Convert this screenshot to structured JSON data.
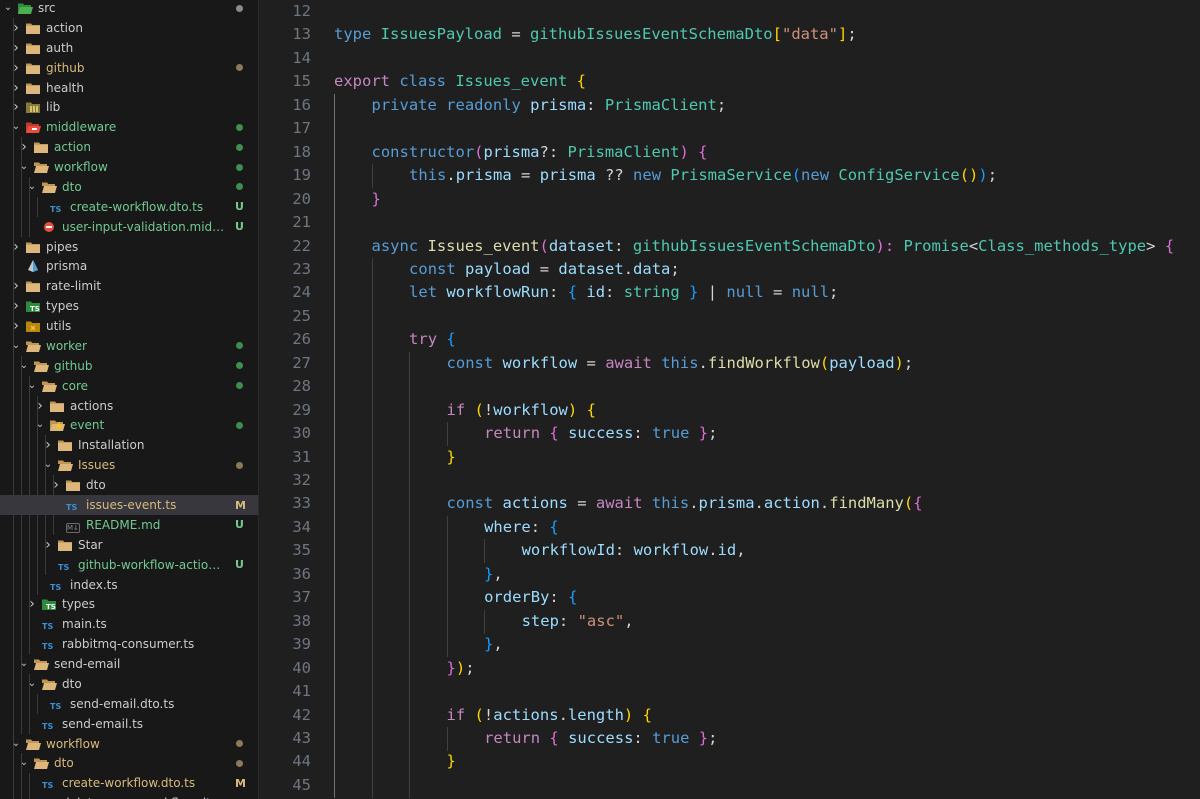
{
  "explorer": {
    "items": [
      {
        "label": "src",
        "kind": "folder-src",
        "depth": 0,
        "state": "open",
        "dot": "#8b8b8b"
      },
      {
        "label": "action",
        "kind": "folder",
        "depth": 1,
        "state": "closed"
      },
      {
        "label": "auth",
        "kind": "folder",
        "depth": 1,
        "state": "closed"
      },
      {
        "label": "github",
        "kind": "folder",
        "depth": 1,
        "state": "closed",
        "labelColor": "#d7ba7d",
        "dot": "#8a7a5a"
      },
      {
        "label": "health",
        "kind": "folder",
        "depth": 1,
        "state": "closed"
      },
      {
        "label": "lib",
        "kind": "folder-lib",
        "depth": 1,
        "state": "closed"
      },
      {
        "label": "middleware",
        "kind": "folder-mw",
        "depth": 1,
        "state": "open",
        "labelColor": "#73c991",
        "dot": "#3e8f4f"
      },
      {
        "label": "action",
        "kind": "folder",
        "depth": 2,
        "state": "closed",
        "labelColor": "#73c991",
        "dot": "#3e8f4f"
      },
      {
        "label": "workflow",
        "kind": "folder",
        "depth": 2,
        "state": "open",
        "labelColor": "#73c991",
        "dot": "#3e8f4f"
      },
      {
        "label": "dto",
        "kind": "folder",
        "depth": 3,
        "state": "open",
        "labelColor": "#73c991",
        "dot": "#3e8f4f"
      },
      {
        "label": "create-workflow.dto.ts",
        "kind": "ts",
        "depth": 4,
        "labelColor": "#73c991",
        "badge": "U",
        "badgeColor": "#73c991"
      },
      {
        "label": "user-input-validation.middlewar...",
        "kind": "mw",
        "depth": 3,
        "labelColor": "#73c991",
        "badge": "U",
        "badgeColor": "#73c991"
      },
      {
        "label": "pipes",
        "kind": "folder",
        "depth": 1,
        "state": "closed"
      },
      {
        "label": "prisma",
        "kind": "prisma",
        "depth": 1,
        "state": "closed"
      },
      {
        "label": "rate-limit",
        "kind": "folder",
        "depth": 1,
        "state": "closed"
      },
      {
        "label": "types",
        "kind": "folder-types",
        "depth": 1,
        "state": "closed"
      },
      {
        "label": "utils",
        "kind": "folder-utils",
        "depth": 1,
        "state": "closed"
      },
      {
        "label": "worker",
        "kind": "folder",
        "depth": 1,
        "state": "open",
        "labelColor": "#73c991",
        "dot": "#3e8f4f"
      },
      {
        "label": "github",
        "kind": "folder",
        "depth": 2,
        "state": "open",
        "labelColor": "#73c991",
        "dot": "#3e8f4f"
      },
      {
        "label": "core",
        "kind": "folder",
        "depth": 3,
        "state": "open",
        "labelColor": "#73c991",
        "dot": "#3e8f4f"
      },
      {
        "label": "actions",
        "kind": "folder",
        "depth": 4,
        "state": "closed"
      },
      {
        "label": "event",
        "kind": "folder-event",
        "depth": 4,
        "state": "open",
        "labelColor": "#73c991",
        "dot": "#3e8f4f"
      },
      {
        "label": "Installation",
        "kind": "folder",
        "depth": 5,
        "state": "closed"
      },
      {
        "label": "Issues",
        "kind": "folder",
        "depth": 5,
        "state": "open",
        "labelColor": "#d7ba7d",
        "dot": "#8a7a5a"
      },
      {
        "label": "dto",
        "kind": "folder",
        "depth": 6,
        "state": "closed"
      },
      {
        "label": "issues-event.ts",
        "kind": "ts",
        "depth": 6,
        "labelColor": "#d7ba7d",
        "badge": "M",
        "badgeColor": "#d7ba7d",
        "selected": true
      },
      {
        "label": "README.md",
        "kind": "md",
        "depth": 6,
        "labelColor": "#73c991",
        "badge": "U",
        "badgeColor": "#73c991"
      },
      {
        "label": "Star",
        "kind": "folder",
        "depth": 5,
        "state": "closed"
      },
      {
        "label": "github-workflow-action-rules...",
        "kind": "ts",
        "depth": 5,
        "labelColor": "#73c991",
        "badge": "U",
        "badgeColor": "#73c991"
      },
      {
        "label": "index.ts",
        "kind": "ts",
        "depth": 4
      },
      {
        "label": "types",
        "kind": "folder-types",
        "depth": 3,
        "state": "closed"
      },
      {
        "label": "main.ts",
        "kind": "ts",
        "depth": 3
      },
      {
        "label": "rabbitmq-consumer.ts",
        "kind": "ts",
        "depth": 3
      },
      {
        "label": "send-email",
        "kind": "folder",
        "depth": 2,
        "state": "open"
      },
      {
        "label": "dto",
        "kind": "folder",
        "depth": 3,
        "state": "open"
      },
      {
        "label": "send-email.dto.ts",
        "kind": "ts",
        "depth": 4
      },
      {
        "label": "send-email.ts",
        "kind": "ts",
        "depth": 3
      },
      {
        "label": "workflow",
        "kind": "folder",
        "depth": 1,
        "state": "open",
        "labelColor": "#d7ba7d",
        "dot": "#8a7a5a"
      },
      {
        "label": "dto",
        "kind": "folder",
        "depth": 2,
        "state": "open",
        "labelColor": "#d7ba7d",
        "dot": "#8a7a5a"
      },
      {
        "label": "create-workflow.dto.ts",
        "kind": "ts",
        "depth": 3,
        "labelColor": "#d7ba7d",
        "badge": "M",
        "badgeColor": "#d7ba7d"
      },
      {
        "label": "delete-many-workflow.dto.ts",
        "kind": "ts",
        "depth": 3
      }
    ]
  },
  "editor": {
    "lines": [
      {
        "n": "12",
        "indent": 0,
        "tokens": []
      },
      {
        "n": "13",
        "indent": 0,
        "tokens": [
          [
            "type ",
            "kw"
          ],
          [
            "IssuesPayload",
            "ty"
          ],
          [
            " = ",
            "df"
          ],
          [
            "githubIssuesEventSchemaDto",
            "ty"
          ],
          [
            "[",
            "p1"
          ],
          [
            "\"data\"",
            "str"
          ],
          [
            "]",
            "p1"
          ],
          [
            ";",
            "df"
          ]
        ]
      },
      {
        "n": "14",
        "indent": 0,
        "tokens": []
      },
      {
        "n": "15",
        "indent": 0,
        "tokens": [
          [
            "export ",
            "ctl"
          ],
          [
            "class ",
            "kw"
          ],
          [
            "Issues_event ",
            "ty"
          ],
          [
            "{",
            "p1"
          ]
        ]
      },
      {
        "n": "16",
        "indent": 1,
        "tokens": [
          [
            "private ",
            "kw"
          ],
          [
            "readonly ",
            "kw"
          ],
          [
            "prisma",
            "vr"
          ],
          [
            ": ",
            "df"
          ],
          [
            "PrismaClient",
            "ty"
          ],
          [
            ";",
            "df"
          ]
        ]
      },
      {
        "n": "17",
        "indent": 1,
        "tokens": []
      },
      {
        "n": "18",
        "indent": 1,
        "tokens": [
          [
            "constructor",
            "kw"
          ],
          [
            "(",
            "p2"
          ],
          [
            "prisma",
            "vr"
          ],
          [
            "?: ",
            "df"
          ],
          [
            "PrismaClient",
            "ty"
          ],
          [
            ") ",
            "p2"
          ],
          [
            "{",
            "p2"
          ]
        ]
      },
      {
        "n": "19",
        "indent": 2,
        "tokens": [
          [
            "this",
            "kw"
          ],
          [
            ".",
            "df"
          ],
          [
            "prisma",
            "vr"
          ],
          [
            " = ",
            "df"
          ],
          [
            "prisma",
            "vr"
          ],
          [
            " ?? ",
            "df"
          ],
          [
            "new ",
            "kw"
          ],
          [
            "PrismaService",
            "ty"
          ],
          [
            "(",
            "p3"
          ],
          [
            "new ",
            "kw"
          ],
          [
            "ConfigService",
            "ty"
          ],
          [
            "()",
            "p1"
          ],
          [
            ")",
            "p3"
          ],
          [
            ";",
            "df"
          ]
        ]
      },
      {
        "n": "20",
        "indent": 1,
        "tokens": [
          [
            "}",
            "p2"
          ]
        ]
      },
      {
        "n": "21",
        "indent": 1,
        "tokens": []
      },
      {
        "n": "22",
        "indent": 1,
        "tokens": [
          [
            "async ",
            "kw"
          ],
          [
            "Issues_event",
            "fn"
          ],
          [
            "(",
            "p2"
          ],
          [
            "dataset",
            "vr"
          ],
          [
            ": ",
            "df"
          ],
          [
            "githubIssuesEventSchemaDto",
            "ty"
          ],
          [
            "): ",
            "p2"
          ],
          [
            "Promise",
            "ty"
          ],
          [
            "<",
            "df"
          ],
          [
            "Class_methods_type",
            "ty"
          ],
          [
            "> ",
            "df"
          ],
          [
            "{",
            "p2"
          ]
        ]
      },
      {
        "n": "23",
        "indent": 2,
        "tokens": [
          [
            "const ",
            "kw"
          ],
          [
            "payload",
            "vr"
          ],
          [
            " = ",
            "df"
          ],
          [
            "dataset",
            "vr"
          ],
          [
            ".",
            "df"
          ],
          [
            "data",
            "vr"
          ],
          [
            ";",
            "df"
          ]
        ]
      },
      {
        "n": "24",
        "indent": 2,
        "tokens": [
          [
            "let ",
            "kw"
          ],
          [
            "workflowRun",
            "vr"
          ],
          [
            ": ",
            "df"
          ],
          [
            "{ ",
            "p3"
          ],
          [
            "id",
            "vr"
          ],
          [
            ": ",
            "df"
          ],
          [
            "string ",
            "ty"
          ],
          [
            "}",
            "p3"
          ],
          [
            " | ",
            "df"
          ],
          [
            "null",
            "kw"
          ],
          [
            " = ",
            "df"
          ],
          [
            "null",
            "kw"
          ],
          [
            ";",
            "df"
          ]
        ]
      },
      {
        "n": "25",
        "indent": 2,
        "tokens": []
      },
      {
        "n": "26",
        "indent": 2,
        "tokens": [
          [
            "try ",
            "ctl"
          ],
          [
            "{",
            "p3"
          ]
        ]
      },
      {
        "n": "27",
        "indent": 3,
        "tokens": [
          [
            "const ",
            "kw"
          ],
          [
            "workflow",
            "vr"
          ],
          [
            " = ",
            "df"
          ],
          [
            "await ",
            "ctl"
          ],
          [
            "this",
            "kw"
          ],
          [
            ".",
            "df"
          ],
          [
            "findWorkflow",
            "fn"
          ],
          [
            "(",
            "p1"
          ],
          [
            "payload",
            "vr"
          ],
          [
            ")",
            "p1"
          ],
          [
            ";",
            "df"
          ]
        ]
      },
      {
        "n": "28",
        "indent": 3,
        "tokens": []
      },
      {
        "n": "29",
        "indent": 3,
        "tokens": [
          [
            "if ",
            "ctl"
          ],
          [
            "(",
            "p1"
          ],
          [
            "!",
            "df"
          ],
          [
            "workflow",
            "vr"
          ],
          [
            ") ",
            "p1"
          ],
          [
            "{",
            "p1"
          ]
        ]
      },
      {
        "n": "30",
        "indent": 4,
        "tokens": [
          [
            "return ",
            "ctl"
          ],
          [
            "{ ",
            "p2"
          ],
          [
            "success",
            "vr"
          ],
          [
            ": ",
            "df"
          ],
          [
            "true ",
            "kw"
          ],
          [
            "}",
            "p2"
          ],
          [
            ";",
            "df"
          ]
        ]
      },
      {
        "n": "31",
        "indent": 3,
        "tokens": [
          [
            "}",
            "p1"
          ]
        ]
      },
      {
        "n": "32",
        "indent": 3,
        "tokens": []
      },
      {
        "n": "33",
        "indent": 3,
        "tokens": [
          [
            "const ",
            "kw"
          ],
          [
            "actions",
            "vr"
          ],
          [
            " = ",
            "df"
          ],
          [
            "await ",
            "ctl"
          ],
          [
            "this",
            "kw"
          ],
          [
            ".",
            "df"
          ],
          [
            "prisma",
            "vr"
          ],
          [
            ".",
            "df"
          ],
          [
            "action",
            "vr"
          ],
          [
            ".",
            "df"
          ],
          [
            "findMany",
            "fn"
          ],
          [
            "(",
            "p1"
          ],
          [
            "{",
            "p2"
          ]
        ]
      },
      {
        "n": "34",
        "indent": 4,
        "tokens": [
          [
            "where",
            "vr"
          ],
          [
            ": ",
            "df"
          ],
          [
            "{",
            "p3"
          ]
        ]
      },
      {
        "n": "35",
        "indent": 5,
        "tokens": [
          [
            "workflowId",
            "vr"
          ],
          [
            ": ",
            "df"
          ],
          [
            "workflow",
            "vr"
          ],
          [
            ".",
            "df"
          ],
          [
            "id",
            "vr"
          ],
          [
            ",",
            "df"
          ]
        ]
      },
      {
        "n": "36",
        "indent": 4,
        "tokens": [
          [
            "}",
            "p3"
          ],
          [
            ",",
            "df"
          ]
        ]
      },
      {
        "n": "37",
        "indent": 4,
        "tokens": [
          [
            "orderBy",
            "vr"
          ],
          [
            ": ",
            "df"
          ],
          [
            "{",
            "p3"
          ]
        ]
      },
      {
        "n": "38",
        "indent": 5,
        "tokens": [
          [
            "step",
            "vr"
          ],
          [
            ": ",
            "df"
          ],
          [
            "\"asc\"",
            "str"
          ],
          [
            ",",
            "df"
          ]
        ]
      },
      {
        "n": "39",
        "indent": 4,
        "tokens": [
          [
            "}",
            "p3"
          ],
          [
            ",",
            "df"
          ]
        ]
      },
      {
        "n": "40",
        "indent": 3,
        "tokens": [
          [
            "}",
            "p2"
          ],
          [
            ")",
            "p1"
          ],
          [
            ";",
            "df"
          ]
        ]
      },
      {
        "n": "41",
        "indent": 3,
        "tokens": []
      },
      {
        "n": "42",
        "indent": 3,
        "tokens": [
          [
            "if ",
            "ctl"
          ],
          [
            "(",
            "p1"
          ],
          [
            "!",
            "df"
          ],
          [
            "actions",
            "vr"
          ],
          [
            ".",
            "df"
          ],
          [
            "length",
            "vr"
          ],
          [
            ") ",
            "p1"
          ],
          [
            "{",
            "p1"
          ]
        ]
      },
      {
        "n": "43",
        "indent": 4,
        "tokens": [
          [
            "return ",
            "ctl"
          ],
          [
            "{ ",
            "p2"
          ],
          [
            "success",
            "vr"
          ],
          [
            ": ",
            "df"
          ],
          [
            "true ",
            "kw"
          ],
          [
            "}",
            "p2"
          ],
          [
            ";",
            "df"
          ]
        ]
      },
      {
        "n": "44",
        "indent": 3,
        "tokens": [
          [
            "}",
            "p1"
          ]
        ]
      },
      {
        "n": "45",
        "indent": 3,
        "tokens": []
      }
    ]
  }
}
